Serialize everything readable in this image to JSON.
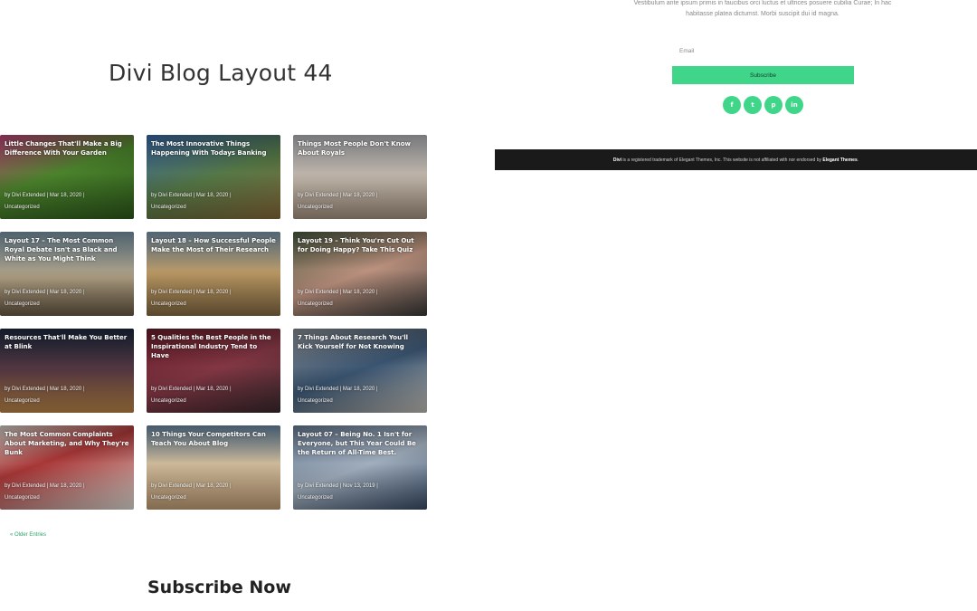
{
  "page_title": "Divi Blog Layout 44",
  "posts": [
    {
      "title": "Little Changes That'll Make a Big Difference With Your Garden",
      "meta": "by Divi Extended | Mar 18, 2020 |",
      "category": "Uncategorized",
      "bg": "linear-gradient(160deg,#c0447a 0%,#4f8a2e 45%,#2e5a1c 100%)"
    },
    {
      "title": "The Most Innovative Things Happening With Todays Banking",
      "meta": "by Divi Extended | Mar 18, 2020 |",
      "category": "Uncategorized",
      "bg": "linear-gradient(160deg,#3b6aa8 0%,#5a7f4a 50%,#8a6b3a 100%)"
    },
    {
      "title": "Things Most People Don't Know About Royals",
      "meta": "by Divi Extended | Mar 18, 2020 |",
      "category": "Uncategorized",
      "bg": "linear-gradient(180deg,#b7b9bd 0%,#c9bdb0 55%,#a89684 100%)"
    },
    {
      "title": "Layout 17 – The Most Common Royal Debate Isn't as Black and White as You Might Think",
      "meta": "by Divi Extended | Mar 18, 2020 |",
      "category": "Uncategorized",
      "bg": "linear-gradient(180deg,#7a96a8 0%,#b7a789 55%,#6b5a45 100%)"
    },
    {
      "title": "Layout 18 – How Successful People Make the Most of Their Research",
      "meta": "by Divi Extended | Mar 18, 2020 |",
      "category": "Uncategorized",
      "bg": "linear-gradient(180deg,#7e9bb0 0%,#c4a068 50%,#8a6e45 100%)"
    },
    {
      "title": "Layout 19 – Think You're Cut Out for Doing Happy? Take This Quiz",
      "meta": "by Divi Extended | Mar 18, 2020 |",
      "category": "Uncategorized",
      "bg": "linear-gradient(160deg,#4a5a40 0%,#c79a86 50%,#3a3a38 100%)"
    },
    {
      "title": "Resources That'll Make You Better at Blink",
      "meta": "by Divi Extended | Mar 18, 2020 |",
      "category": "Uncategorized",
      "bg": "linear-gradient(180deg,#1d2a40 0%,#5a3a44 50%,#c08a4a 100%)"
    },
    {
      "title": "5 Qualities the Best People in the Inspirational Industry Tend to Have",
      "meta": "by Divi Extended | Mar 18, 2020 |",
      "category": "Uncategorized",
      "bg": "linear-gradient(160deg,#6a1e2a 0%,#8a3a48 50%,#3a2a2e 100%)"
    },
    {
      "title": "7 Things About Research You'll Kick Yourself for Not Knowing",
      "meta": "by Divi Extended | Mar 18, 2020 |",
      "category": "Uncategorized",
      "bg": "linear-gradient(160deg,#8a9096 0%,#3e5a78 50%,#c8c4bc 100%)"
    },
    {
      "title": "The Most Common Complaints About Marketing, and Why They're Bunk",
      "meta": "by Divi Extended | Mar 18, 2020 |",
      "category": "Uncategorized",
      "bg": "linear-gradient(160deg,#d8d4cc 0%,#b33a3a 40%,#e6e2da 100%)"
    },
    {
      "title": "10 Things Your Competitors Can Teach You About Blog",
      "meta": "by Divi Extended | Mar 18, 2020 |",
      "category": "Uncategorized",
      "bg": "linear-gradient(180deg,#6b8aa6 0%,#d8c3a2 45%,#c7a37a 100%)"
    },
    {
      "title": "Layout 07 – Being No. 1 Isn't for Everyone, but This Year Could Be the Return of All-Time Best.",
      "meta": "by Divi Extended | Nov 13, 2019 |",
      "category": "Uncategorized",
      "bg": "linear-gradient(160deg,#6a7e98 0%,#aab8c8 50%,#3a4e6a 100%)"
    }
  ],
  "pagination": {
    "older_entries": "« Older Entries"
  },
  "subscribe_heading": "Subscribe Now",
  "newsletter": {
    "intro_text": "Vestibulum ante ipsum primis in faucibus orci luctus et ultrices posuere cubilia Curae; In hac habitasse platea dictumst. Morbi suscipit dui id magna.",
    "email_placeholder": "Email",
    "button_label": "Subscribe",
    "accent_color": "#3fd68a"
  },
  "social": [
    {
      "name": "facebook-icon",
      "glyph": "f"
    },
    {
      "name": "twitter-icon",
      "glyph": "t"
    },
    {
      "name": "pinterest-icon",
      "glyph": "p"
    },
    {
      "name": "linkedin-icon",
      "glyph": "in"
    }
  ],
  "footer": {
    "brand": "Divi",
    "text": " is a registered trademark of Elegant Themes, Inc. This website is not affiliated with nor endorsed by ",
    "company": "Elegant Themes",
    "end": "."
  }
}
